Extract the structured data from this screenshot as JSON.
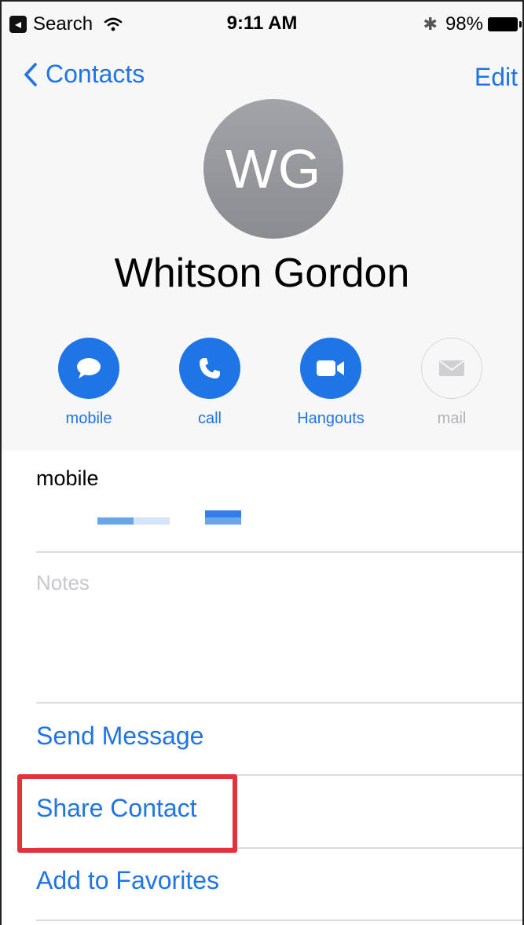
{
  "status_bar": {
    "back_app_label": "Search",
    "time": "9:11 AM",
    "battery": "98%"
  },
  "nav": {
    "back_label": "Contacts",
    "edit_label": "Edit"
  },
  "contact": {
    "initials": "WG",
    "name": "Whitson Gordon"
  },
  "actions": [
    {
      "label": "mobile",
      "icon": "message-icon",
      "enabled": true
    },
    {
      "label": "call",
      "icon": "phone-icon",
      "enabled": true
    },
    {
      "label": "Hangouts",
      "icon": "video-icon",
      "enabled": true
    },
    {
      "label": "mail",
      "icon": "mail-icon",
      "enabled": false
    }
  ],
  "fields": {
    "mobile_label": "mobile",
    "notes_placeholder": "Notes"
  },
  "links": {
    "send_message": "Send Message",
    "share_contact": "Share Contact",
    "add_to_favorites": "Add to Favorites"
  },
  "colors": {
    "accent": "#1f74e6",
    "highlight": "#e3323c"
  }
}
